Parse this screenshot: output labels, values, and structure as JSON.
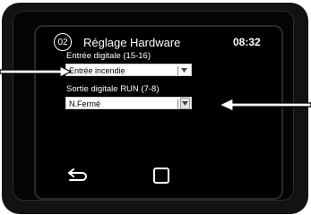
{
  "header": {
    "page_number": "02",
    "title": "Réglage Hardware",
    "time": "08:32"
  },
  "fields": [
    {
      "label": "Entrée digitale (15-16)",
      "value": "Entrée incendie"
    },
    {
      "label": "Sortie digitale RUN (7-8)",
      "value": "N.Fermé"
    }
  ],
  "icons": {
    "back": "back-arrow-icon",
    "home": "home-square-icon",
    "dropdown": "chevron-down-icon"
  },
  "colors": {
    "screen_bg": "#000000",
    "text": "#ffffff",
    "select_bg": "#ffffff"
  }
}
